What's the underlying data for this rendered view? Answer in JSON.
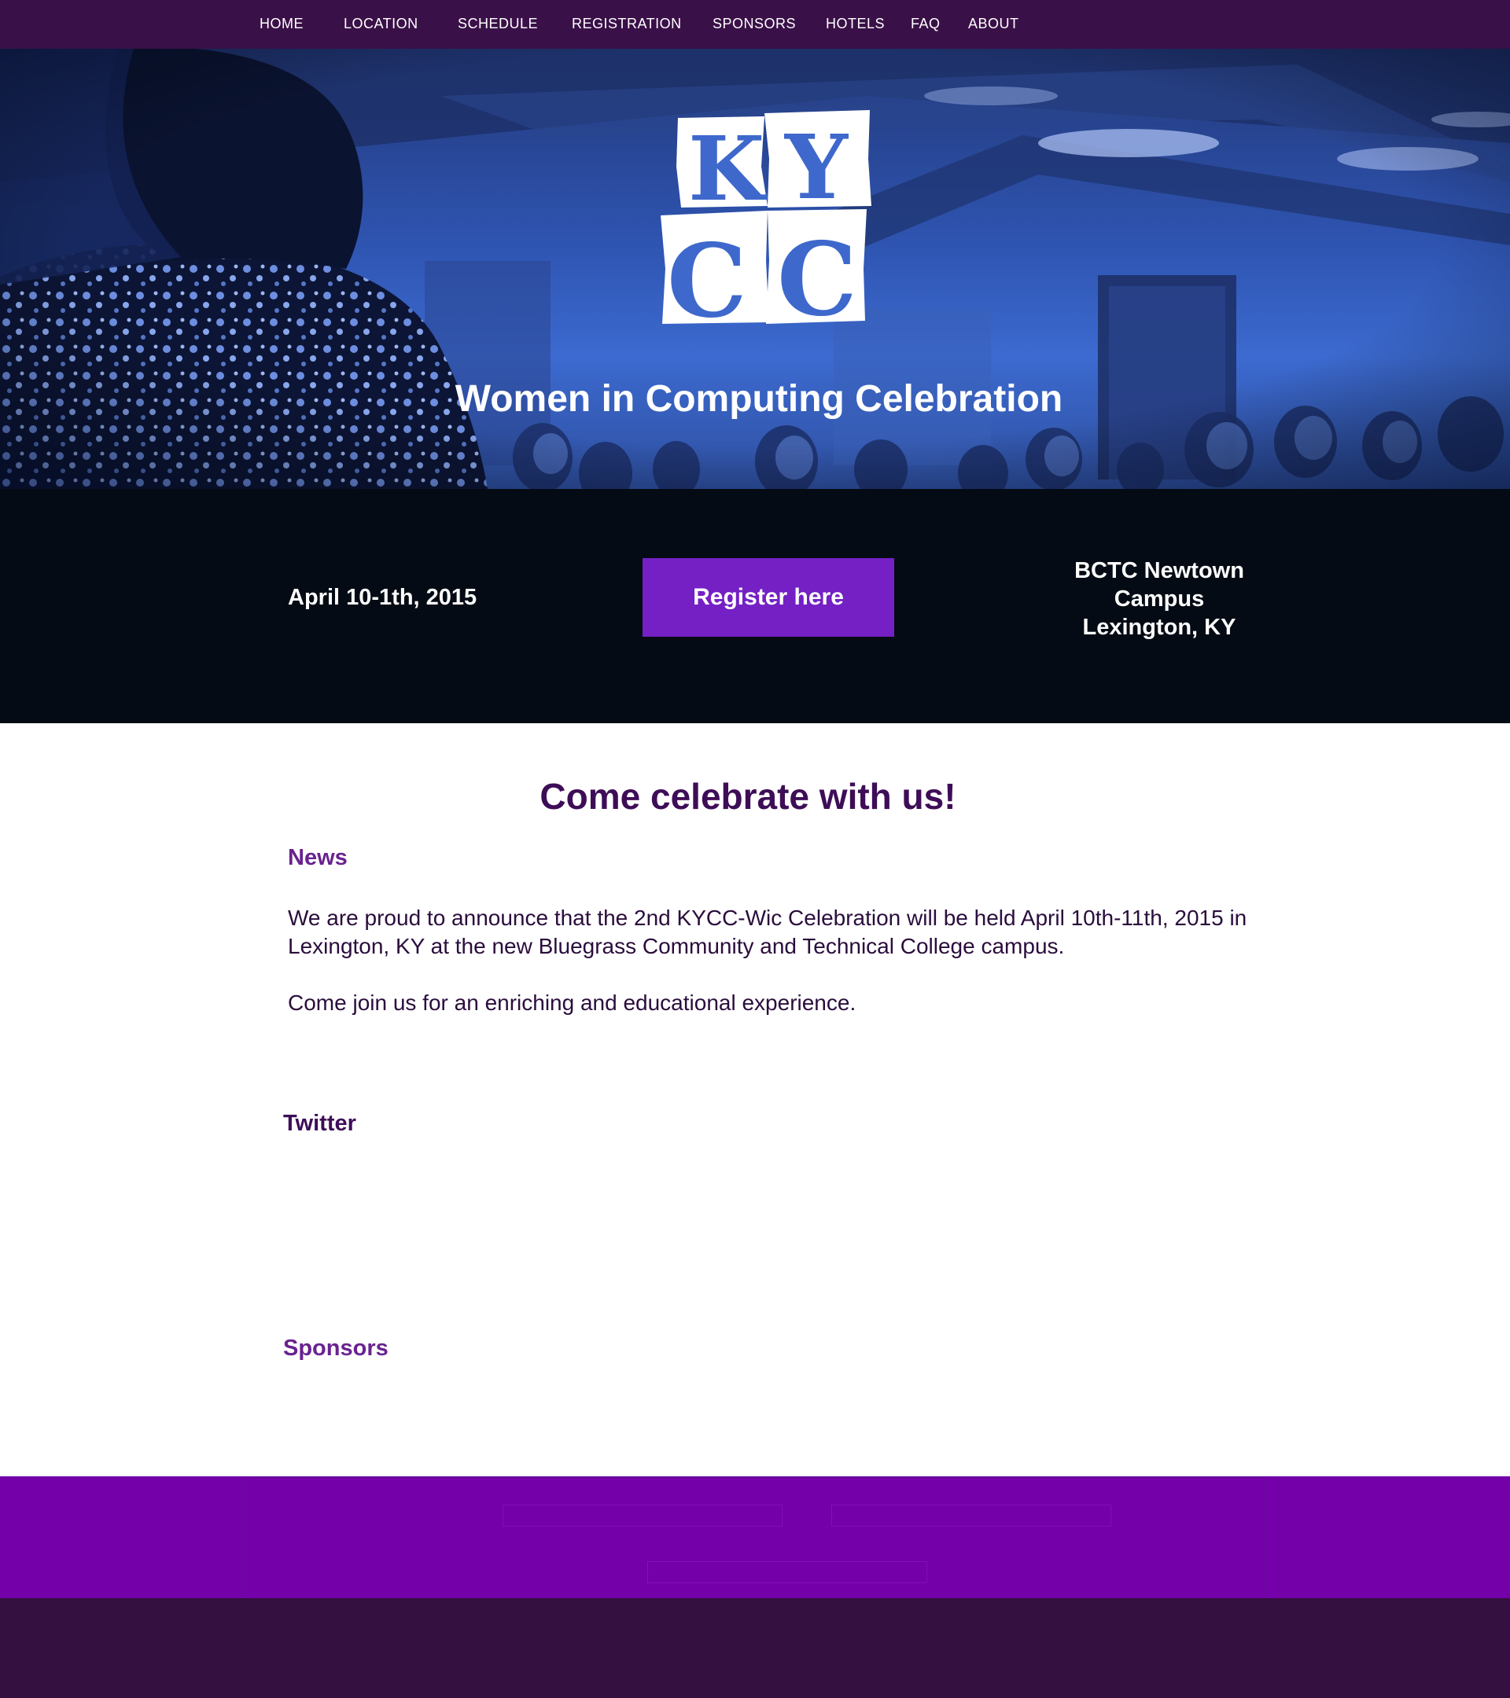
{
  "nav": {
    "items": [
      {
        "label": "HOME"
      },
      {
        "label": "LOCATION"
      },
      {
        "label": "SCHEDULE"
      },
      {
        "label": "REGISTRATION"
      },
      {
        "label": "SPONSORS"
      },
      {
        "label": "HOTELS"
      },
      {
        "label": "FAQ"
      },
      {
        "label": "ABOUT"
      }
    ]
  },
  "hero": {
    "logo_text": [
      "K",
      "Y",
      "C",
      "C"
    ],
    "title": "Women in Computing Celebration"
  },
  "event": {
    "date": "April 10-1th, 2015",
    "register_label": "Register here",
    "venue_lines": [
      "BCTC Newtown",
      "Campus",
      "Lexington, KY"
    ]
  },
  "main": {
    "heading": "Come celebrate with us!",
    "news_heading": "News",
    "news_paragraphs": [
      "We are proud to announce that the 2nd KYCC-Wic Celebration will be held April 10th-11th, 2015 in Lexington, KY at the new Bluegrass Community and Technical College campus.",
      "Come join us for an enriching and educational experience."
    ],
    "twitter_heading": "Twitter",
    "sponsors_heading": "Sponsors"
  },
  "colors": {
    "nav_bg": "#3a1048",
    "accent": "#7420c4",
    "heading_purple": "#3e0d57",
    "subheading_purple": "#6a2290",
    "footer_purple": "#7300a8",
    "page_bottom": "#331040"
  }
}
